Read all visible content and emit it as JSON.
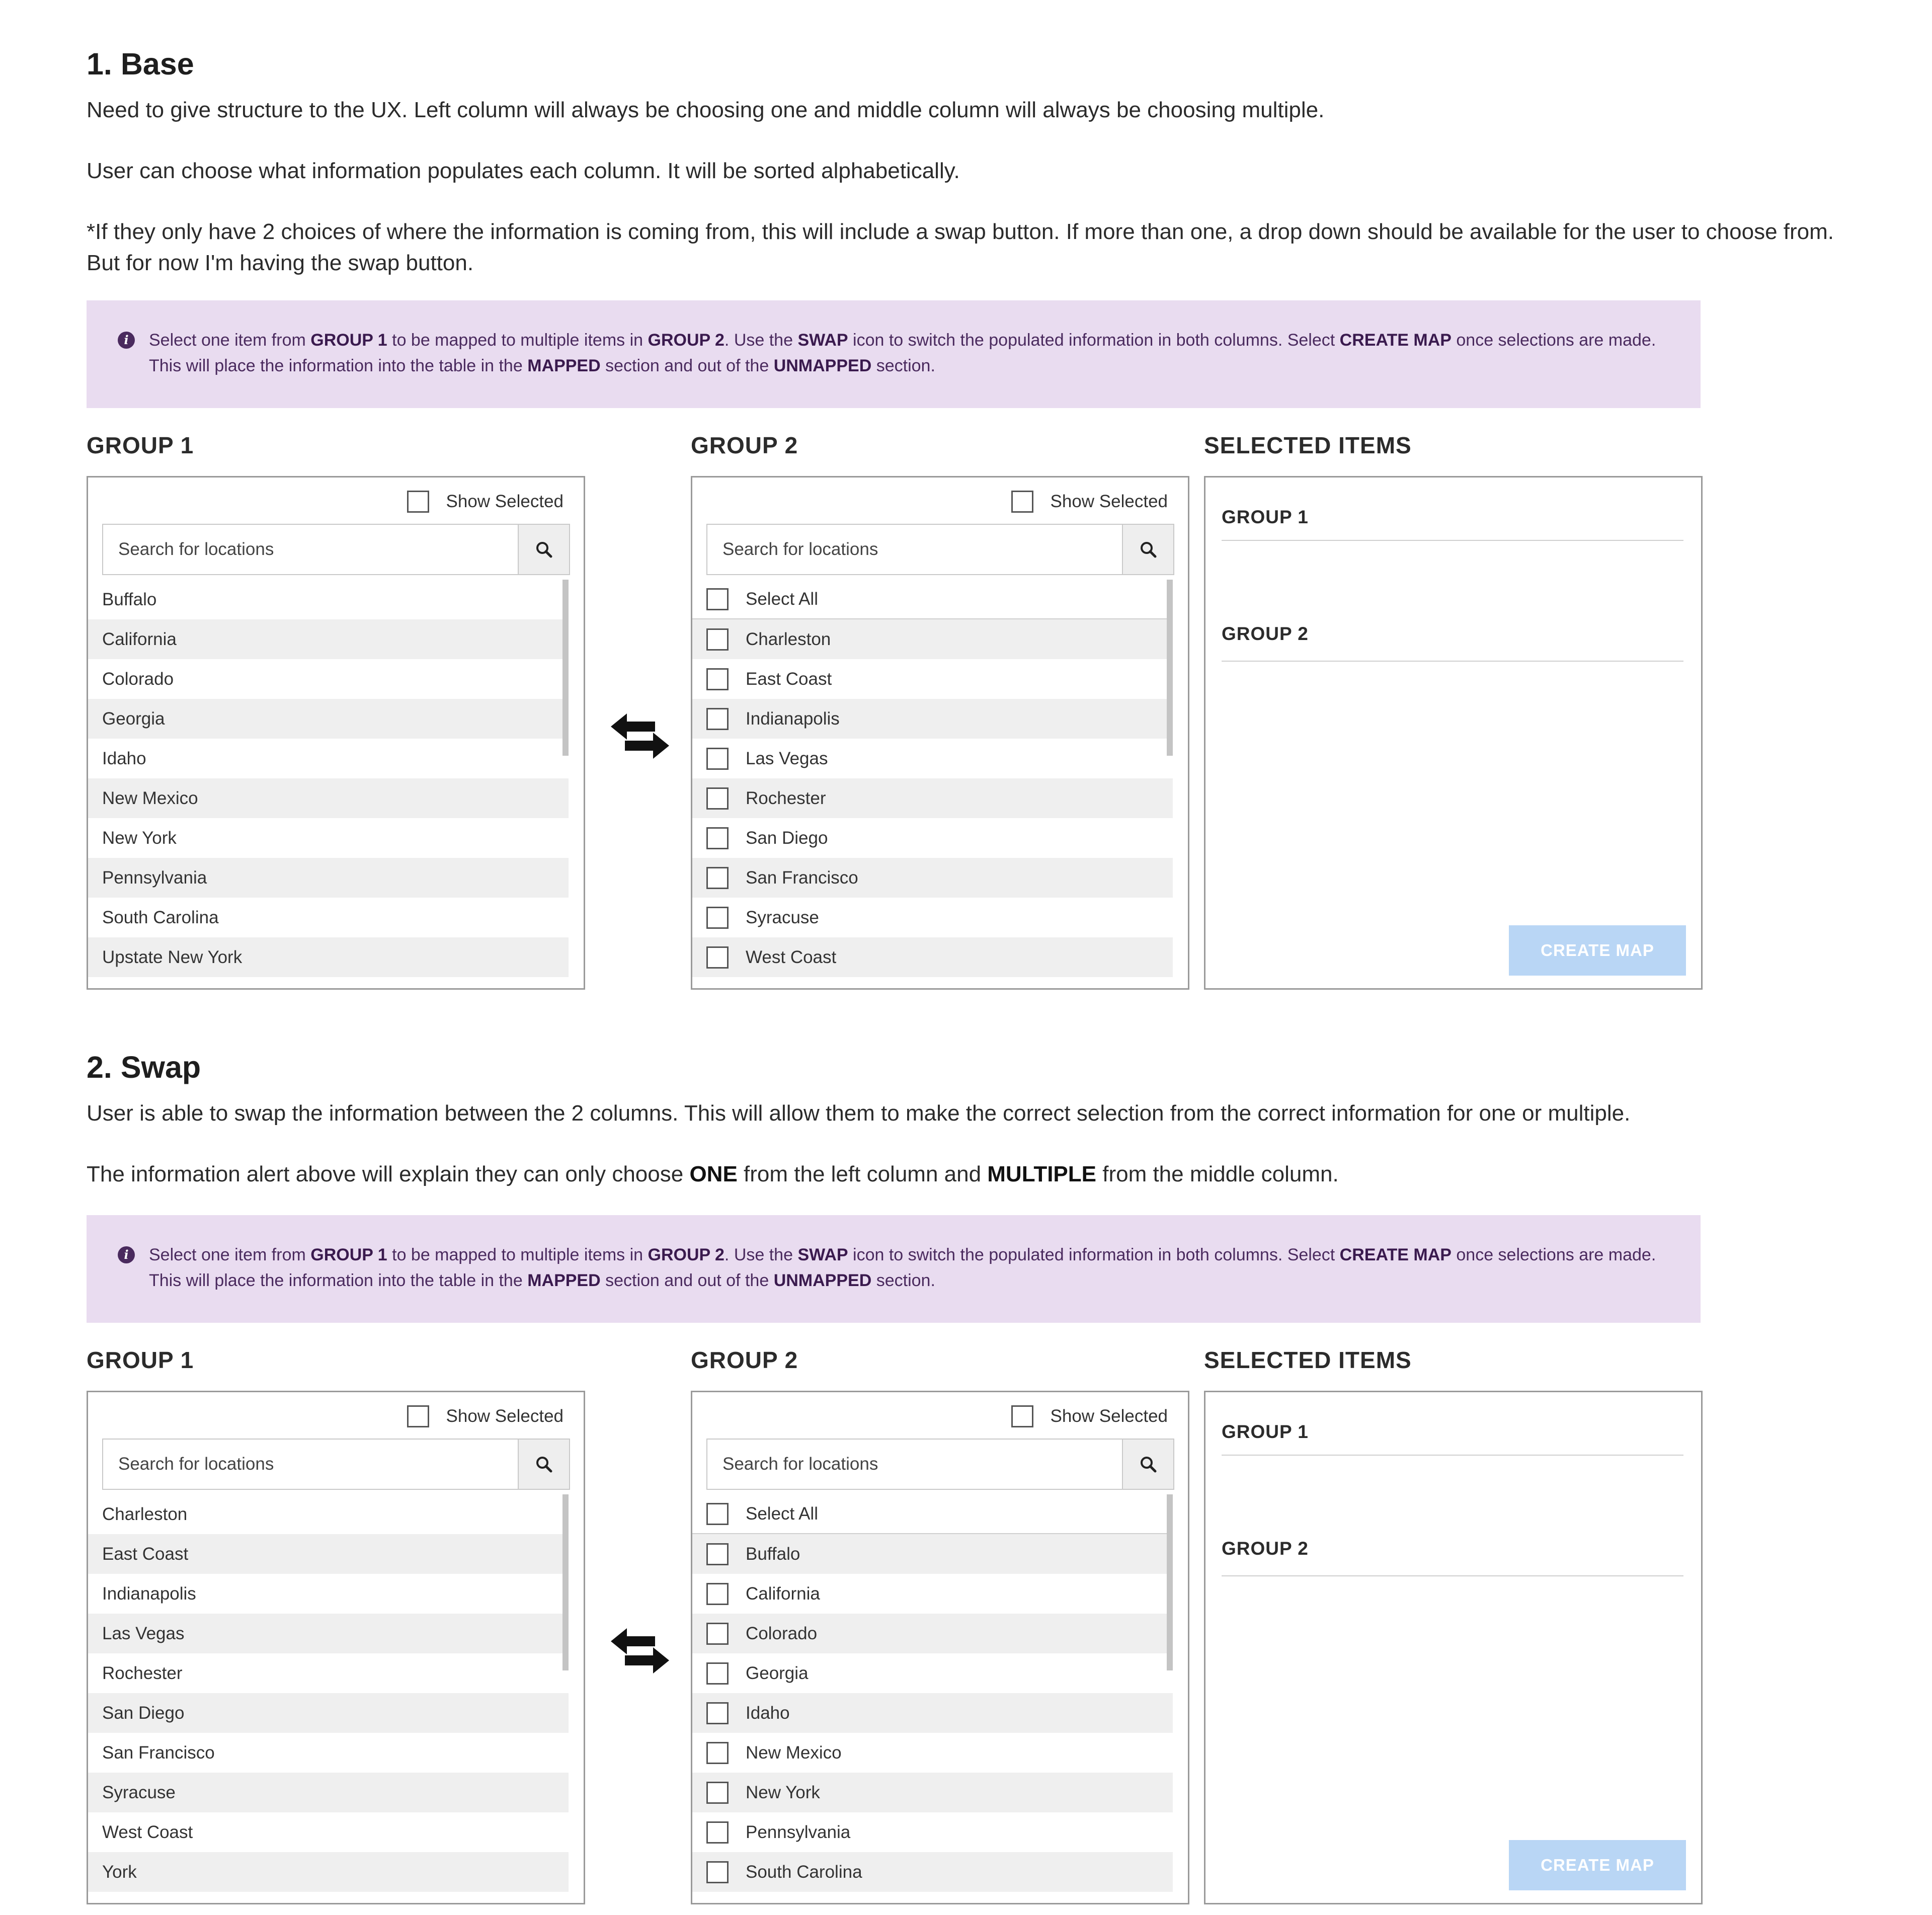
{
  "section1": {
    "title": "1. Base",
    "p1": "Need to give structure to the UX. Left column will always be choosing one and middle column will always be choosing multiple.",
    "p2": "User can choose what information populates each column. It will be sorted alphabetically.",
    "p3": "*If they only have 2 choices of where the information is coming from, this will include a swap button. If more than one, a drop down should be available for the user to choose from. But for now I'm having the swap button."
  },
  "section2": {
    "title": "2. Swap",
    "p1": "User is able to swap the information between the 2 columns. This will allow them to make the correct selection from the correct information for one or multiple.",
    "p2_a": "The information alert above will explain they can only choose ",
    "p2_b": "ONE",
    "p2_c": " from the left column and ",
    "p2_d": "MULTIPLE",
    "p2_e": " from the middle column."
  },
  "alert": {
    "t1": "Select one item from ",
    "b1": "GROUP 1",
    "t2": " to be mapped to multiple items in ",
    "b2": "GROUP 2",
    "t3": ". Use the ",
    "b3": "SWAP",
    "t4": " icon to switch the populated information in both columns. Select ",
    "b4": "CREATE MAP",
    "t5": " once selections are made. This will place the information into the table in the ",
    "b5": "MAPPED",
    "t6": " section and out of the ",
    "b6": "UNMAPPED",
    "t7": " section."
  },
  "labels": {
    "group1": "GROUP 1",
    "group2": "GROUP 2",
    "selected_items": "SELECTED ITEMS",
    "show_selected": "Show Selected",
    "search_placeholder": "Search for locations",
    "select_all": "Select All",
    "create_map": "CREATE MAP"
  },
  "icons": {
    "info": "info-icon",
    "search": "search-icon",
    "swap": "swap-icon"
  },
  "colors": {
    "alert_bg": "#e9dcf0",
    "alert_text": "#4a2a5e",
    "button_disabled": "#b9d6f5"
  },
  "base": {
    "group1_items": [
      "Buffalo",
      "California",
      "Colorado",
      "Georgia",
      "Idaho",
      "New Mexico",
      "New York",
      "Pennsylvania",
      "South Carolina",
      "Upstate New York"
    ],
    "group2_items": [
      "Charleston",
      "East Coast",
      "Indianapolis",
      "Las Vegas",
      "Rochester",
      "San Diego",
      "San Francisco",
      "Syracuse",
      "West Coast"
    ]
  },
  "swapped": {
    "group1_items": [
      "Charleston",
      "East Coast",
      "Indianapolis",
      "Las Vegas",
      "Rochester",
      "San Diego",
      "San Francisco",
      "Syracuse",
      "West Coast",
      "York"
    ],
    "group2_items": [
      "Buffalo",
      "California",
      "Colorado",
      "Georgia",
      "Idaho",
      "New Mexico",
      "New York",
      "Pennsylvania",
      "South Carolina"
    ]
  }
}
